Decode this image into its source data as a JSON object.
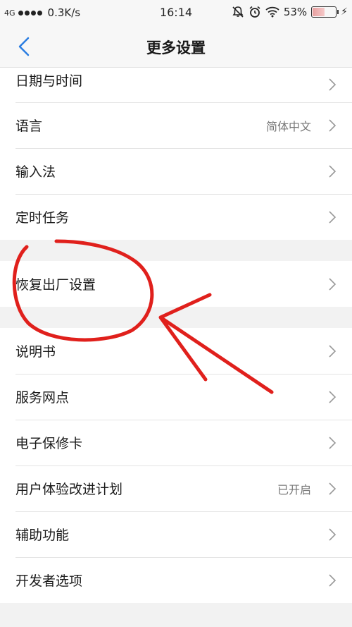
{
  "status_bar": {
    "network": "4G",
    "speed": "0.3K/s",
    "time": "16:14",
    "battery": "53%"
  },
  "header": {
    "title": "更多设置"
  },
  "groups": [
    [
      {
        "label": "日期与时间",
        "value": ""
      },
      {
        "label": "语言",
        "value": "简体中文"
      },
      {
        "label": "输入法",
        "value": ""
      },
      {
        "label": "定时任务",
        "value": ""
      }
    ],
    [
      {
        "label": "恢复出厂设置",
        "value": ""
      }
    ],
    [
      {
        "label": "说明书",
        "value": ""
      },
      {
        "label": "服务网点",
        "value": ""
      },
      {
        "label": "电子保修卡",
        "value": ""
      },
      {
        "label": "用户体验改进计划",
        "value": "已开启"
      },
      {
        "label": "辅助功能",
        "value": ""
      },
      {
        "label": "开发者选项",
        "value": ""
      }
    ]
  ],
  "colors": {
    "background": "#f2f2f2",
    "accent": "#2a7de1",
    "annotation": "#e0201c"
  },
  "icons": [
    "signal-dots-icon",
    "mute-icon",
    "alarm-icon",
    "wifi-icon",
    "battery-icon",
    "charging-icon",
    "back-chevron-icon",
    "chevron-right-icon"
  ]
}
